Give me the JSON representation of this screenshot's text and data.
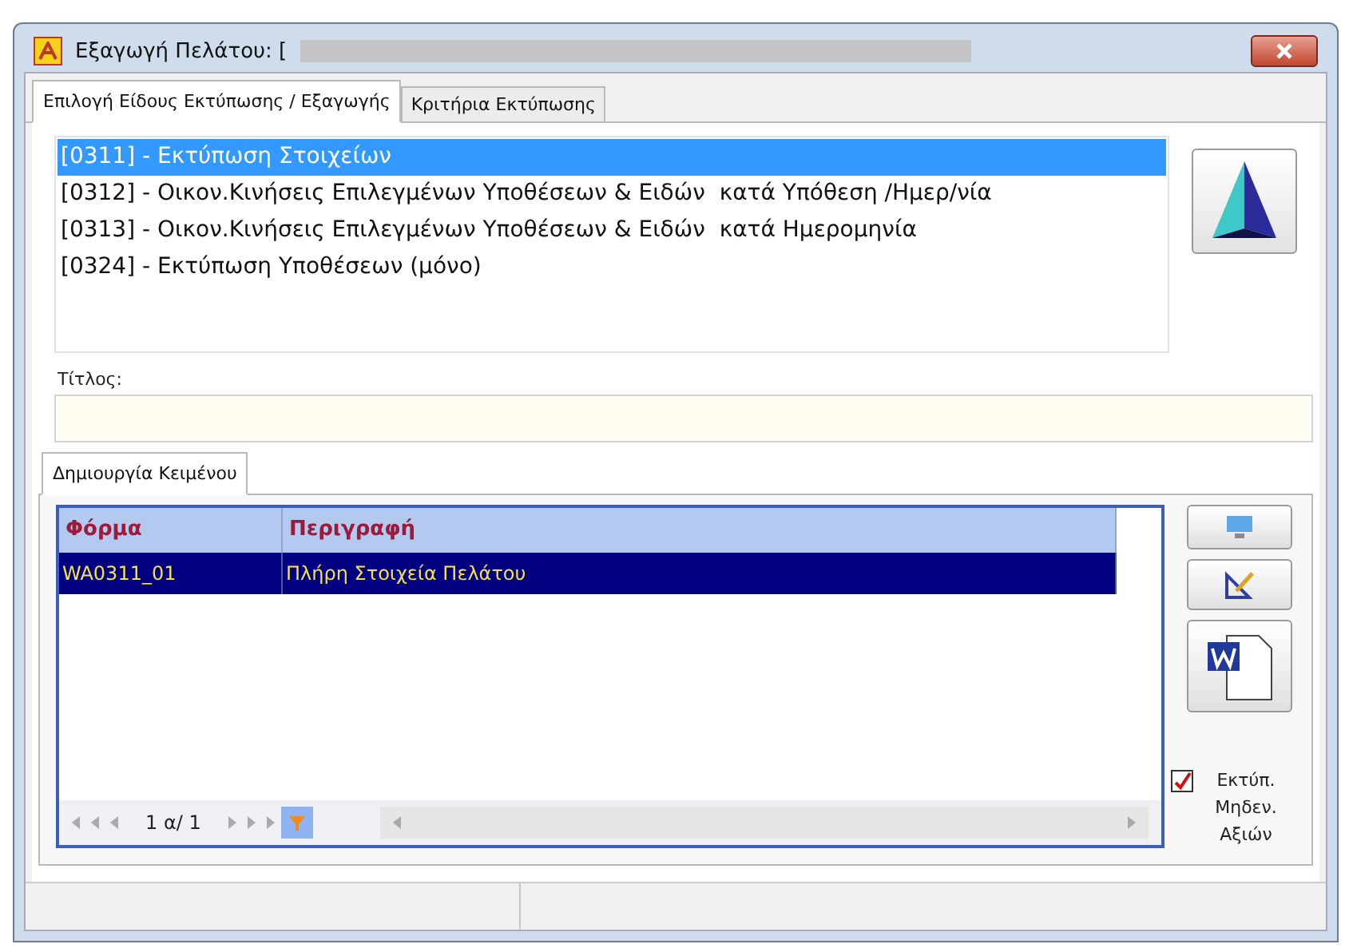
{
  "window": {
    "title": "Εξαγωγή Πελάτου: ["
  },
  "tabs": [
    {
      "label": "Επιλογή Είδους Εκτύπωσης / Εξαγωγής",
      "selected": true
    },
    {
      "label": "Κριτήρια Εκτύπωσης",
      "selected": false
    }
  ],
  "reports": [
    {
      "label": "[0311] - Εκτύπωση Στοιχείων",
      "selected": true
    },
    {
      "label": "[0312] - Οικον.Κινήσεις Επιλεγμένων Υποθέσεων & Ειδών  κατά Υπόθεση /Ημερ/νία",
      "selected": false
    },
    {
      "label": "[0313] - Οικον.Κινήσεις Επιλεγμένων Υποθέσεων & Ειδών  κατά Ημερομηνία",
      "selected": false
    },
    {
      "label": "[0324] - Εκτύπωση Υποθέσεων (μόνο)",
      "selected": false
    }
  ],
  "title_field": {
    "label": "Τίτλος:"
  },
  "inner_tabs": [
    {
      "label": "Δημιουργία Κειμένου",
      "selected": true
    }
  ],
  "grid": {
    "columns": [
      "Φόρμα",
      "Περιγραφή"
    ],
    "rows": [
      {
        "cells": [
          "WA0311_01",
          "Πλήρη Στοιχεία Πελάτου"
        ],
        "selected": true
      }
    ],
    "pager": "1 α/ 1"
  },
  "print_zero": {
    "label": "Εκτύπ. Μηδεν. Αξιών",
    "checked": true
  }
}
